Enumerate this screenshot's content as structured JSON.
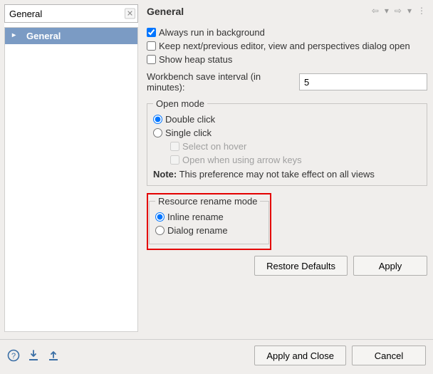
{
  "sidebar": {
    "search_value": "General",
    "items": [
      {
        "label": "General",
        "selected": true
      }
    ]
  },
  "header": {
    "title": "General"
  },
  "checks": {
    "always_run_bg": {
      "label": "Always run in background",
      "checked": true
    },
    "keep_dialog": {
      "label": "Keep next/previous editor, view and perspectives dialog open",
      "checked": false
    },
    "show_heap": {
      "label": "Show heap status",
      "checked": false
    }
  },
  "save_interval": {
    "label": "Workbench save interval (in minutes):",
    "value": "5"
  },
  "open_mode": {
    "legend": "Open mode",
    "double_click": "Double click",
    "single_click": "Single click",
    "select_hover": "Select on hover",
    "open_arrow": "Open when using arrow keys",
    "note_prefix": "Note:",
    "note_text": " This preference may not take effect on all views"
  },
  "rename_mode": {
    "legend": "Resource rename mode",
    "inline": "Inline rename",
    "dialog": "Dialog rename"
  },
  "buttons": {
    "restore": "Restore Defaults",
    "apply": "Apply",
    "apply_close": "Apply and Close",
    "cancel": "Cancel"
  }
}
